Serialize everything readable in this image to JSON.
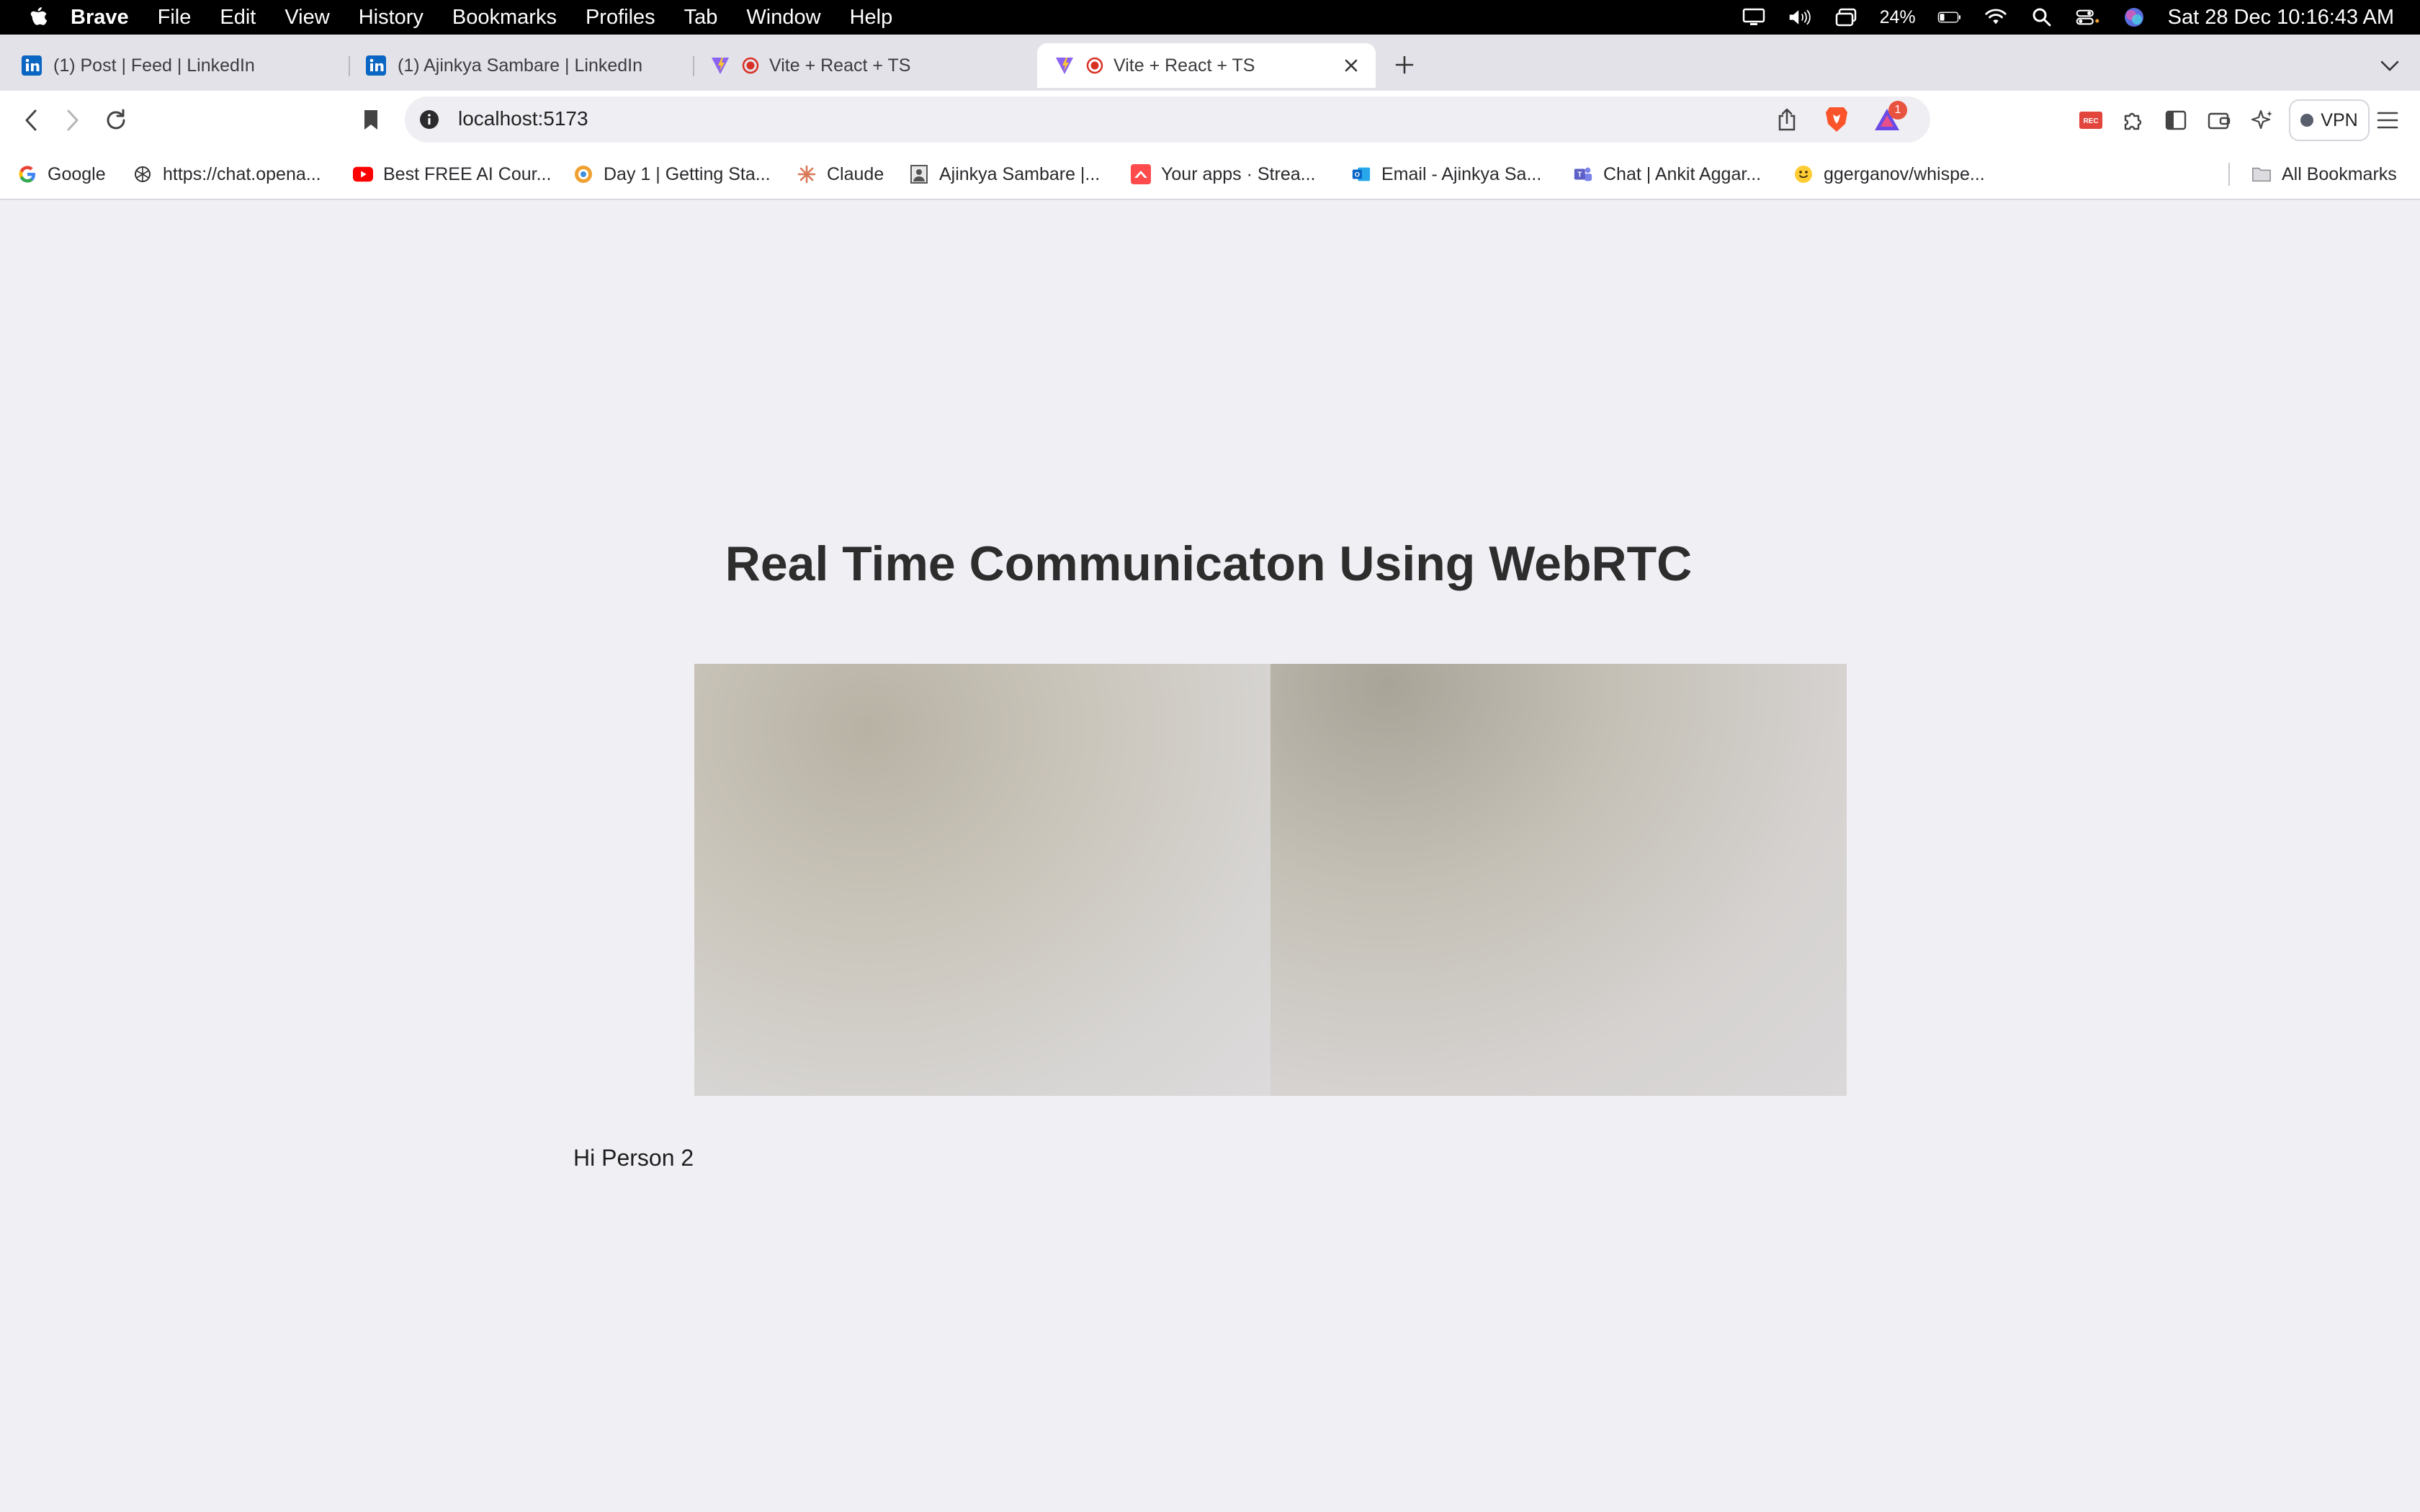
{
  "menubar": {
    "app_name": "Brave",
    "items": [
      "File",
      "Edit",
      "View",
      "History",
      "Bookmarks",
      "Profiles",
      "Tab",
      "Window",
      "Help"
    ],
    "battery": "24%",
    "clock": "Sat 28 Dec  10:16:43 AM"
  },
  "tabs": [
    {
      "title": "(1) Post | Feed | LinkedIn",
      "icon": "linkedin-icon",
      "active": false
    },
    {
      "title": "(1) Ajinkya Sambare | LinkedIn",
      "icon": "linkedin-icon",
      "active": false
    },
    {
      "title": "Vite + React + TS",
      "icon": "vite-icon",
      "recording": true,
      "active": false
    },
    {
      "title": "Vite + React + TS",
      "icon": "vite-icon",
      "recording": true,
      "active": true
    }
  ],
  "toolbar": {
    "url": "localhost:5173",
    "rewards_badge": "1",
    "vpn_label": "VPN"
  },
  "bookmarks": [
    {
      "label": "Google",
      "icon": "google-icon",
      "color": "#4285f4"
    },
    {
      "label": "https://chat.opena...",
      "icon": "openai-icon",
      "color": "#333333"
    },
    {
      "label": "Best FREE AI Cour...",
      "icon": "youtube-icon",
      "color": "#ff0000"
    },
    {
      "label": "Day 1 | Getting Sta...",
      "icon": "course-icon",
      "color": "#f0a030"
    },
    {
      "label": "Claude",
      "icon": "claude-icon",
      "color": "#d97757"
    },
    {
      "label": "Ajinkya Sambare |...",
      "icon": "profile-icon",
      "color": "#555555"
    },
    {
      "label": "Your apps · Strea...",
      "icon": "streamlit-icon",
      "color": "#ff4b4b"
    },
    {
      "label": "Email - Ajinkya Sa...",
      "icon": "outlook-icon",
      "color": "#0a64c8"
    },
    {
      "label": "Chat | Ankit Aggar...",
      "icon": "teams-icon",
      "color": "#5b5fc7"
    },
    {
      "label": "ggerganov/whispe...",
      "icon": "huggingface-icon",
      "color": "#ffcc33"
    }
  ],
  "all_bookmarks_label": "All Bookmarks",
  "page": {
    "title": "Real Time Communicaton Using WebRTC",
    "message": "Hi Person 2"
  }
}
